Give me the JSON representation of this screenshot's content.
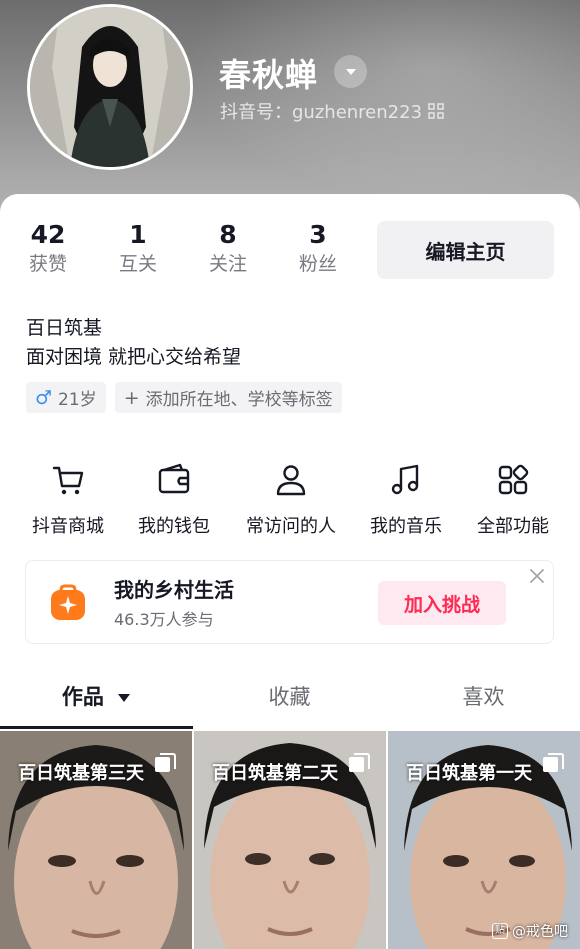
{
  "profile": {
    "nickname": "春秋蝉",
    "douyin_id": "抖音号：guzhenren223"
  },
  "stats": [
    {
      "value": "42",
      "label": "获赞"
    },
    {
      "value": "1",
      "label": "互关"
    },
    {
      "value": "8",
      "label": "关注"
    },
    {
      "value": "3",
      "label": "粉丝"
    }
  ],
  "edit_button": "编辑主页",
  "bio": {
    "line1": "百日筑基",
    "line2": "面对困境 就把心交给希望"
  },
  "tags": {
    "age": "21岁",
    "add": "添加所在地、学校等标签"
  },
  "functions": [
    {
      "label": "抖音商城",
      "icon": "cart-icon"
    },
    {
      "label": "我的钱包",
      "icon": "wallet-icon"
    },
    {
      "label": "常访问的人",
      "icon": "person-icon"
    },
    {
      "label": "我的音乐",
      "icon": "music-note-icon"
    },
    {
      "label": "全部功能",
      "icon": "grid-icon"
    }
  ],
  "banner": {
    "title": "我的乡村生活",
    "subtitle": "46.3万人参与",
    "button": "加入挑战"
  },
  "tabs": [
    {
      "label": "作品",
      "active": true
    },
    {
      "label": "收藏",
      "active": false
    },
    {
      "label": "喜欢",
      "active": false
    }
  ],
  "videos": [
    {
      "title": "百日筑基第三天"
    },
    {
      "title": "百日筑基第二天"
    },
    {
      "title": "百日筑基第一天"
    }
  ],
  "watermark": "@戒色吧",
  "colors": {
    "accent": "#fe2c55",
    "banner_icon": "#ff7a1a",
    "male": "#3a8ff0",
    "text_primary": "#161823",
    "text_secondary": "#6b6c73"
  }
}
